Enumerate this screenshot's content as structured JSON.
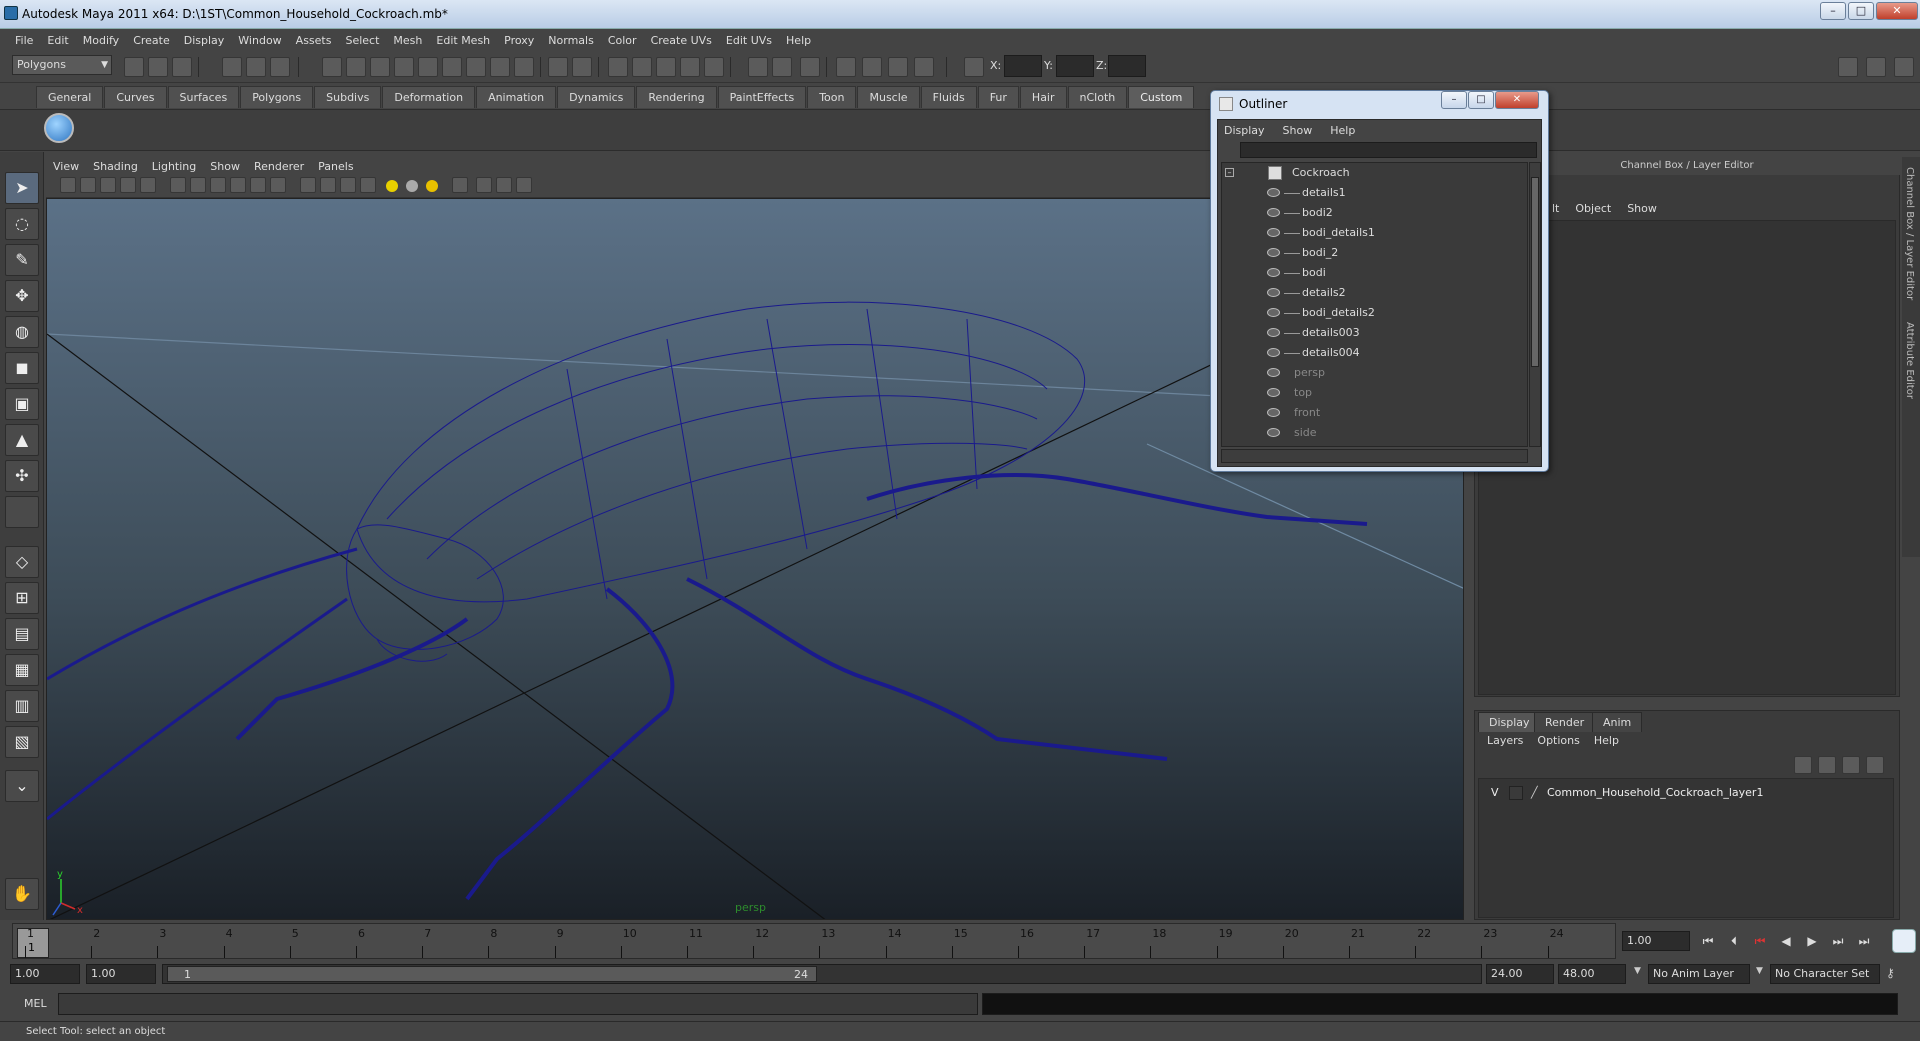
{
  "window": {
    "title": "Autodesk Maya 2011 x64: D:\\1ST\\Common_Household_Cockroach.mb*",
    "controls": [
      "–",
      "□",
      "✕"
    ]
  },
  "menubar": [
    "File",
    "Edit",
    "Modify",
    "Create",
    "Display",
    "Window",
    "Assets",
    "Select",
    "Mesh",
    "Edit Mesh",
    "Proxy",
    "Normals",
    "Color",
    "Create UVs",
    "Edit UVs",
    "Help"
  ],
  "statusline": {
    "menu_set": "Polygons",
    "x_label": "X:",
    "y_label": "Y:",
    "z_label": "Z:"
  },
  "shelf": {
    "tabs": [
      "General",
      "Curves",
      "Surfaces",
      "Polygons",
      "Subdivs",
      "Deformation",
      "Animation",
      "Dynamics",
      "Rendering",
      "PaintEffects",
      "Toon",
      "Muscle",
      "Fluids",
      "Fur",
      "Hair",
      "nCloth",
      "Custom"
    ],
    "active_tab": "Custom"
  },
  "viewport": {
    "menu": [
      "View",
      "Shading",
      "Lighting",
      "Show",
      "Renderer",
      "Panels"
    ],
    "camera_label": "persp",
    "axis_y": "y",
    "axis_x": "x"
  },
  "outliner": {
    "title": "Outliner",
    "menu": [
      "Display",
      "Show",
      "Help"
    ],
    "root": "Cockroach",
    "children": [
      "details1",
      "bodi2",
      "bodi_details1",
      "bodi_2",
      "bodi",
      "details2",
      "bodi_details2",
      "details003",
      "details004"
    ],
    "cameras": [
      "persp",
      "top",
      "front",
      "side"
    ]
  },
  "channel_box": {
    "header": "Channel Box / Layer Editor",
    "menu": [
      "lt",
      "Object",
      "Show"
    ]
  },
  "side_tabs": [
    "Channel Box / Layer Editor",
    "Attribute Editor"
  ],
  "layer_editor": {
    "tabs": [
      "Display",
      "Render",
      "Anim"
    ],
    "active_tab": "Display",
    "menu": [
      "Layers",
      "Options",
      "Help"
    ],
    "layer": {
      "visible": "V",
      "name": "Common_Household_Cockroach_layer1"
    }
  },
  "timeline": {
    "ticks": [
      "1",
      "2",
      "3",
      "4",
      "5",
      "6",
      "7",
      "8",
      "9",
      "10",
      "11",
      "12",
      "13",
      "14",
      "15",
      "16",
      "17",
      "18",
      "19",
      "20",
      "21",
      "22",
      "23",
      "24"
    ],
    "current_frame": "1",
    "current_time_field": "1.00"
  },
  "range": {
    "start_time": "1.00",
    "playback_start": "1.00",
    "range_start_label": "1",
    "range_end_label": "24",
    "playback_end": "24.00",
    "end_time": "48.00",
    "anim_layer": "No Anim Layer",
    "character_set": "No Character Set"
  },
  "command_line": {
    "label": "MEL"
  },
  "help_line": "Select Tool: select an object",
  "colors": {
    "wireframe": "#1a1a8c",
    "viewport_top": "#5b7187",
    "viewport_bottom": "#1a2027",
    "ui_bg": "#444444"
  }
}
